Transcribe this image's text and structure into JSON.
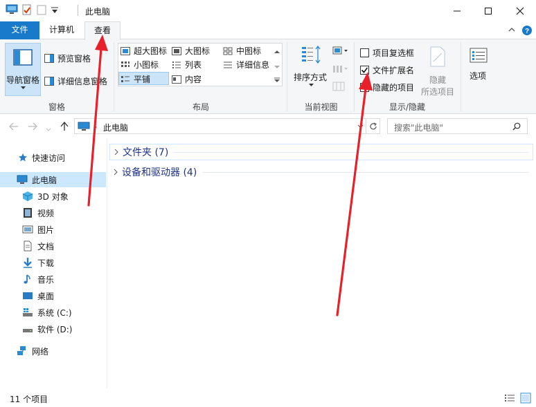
{
  "window": {
    "title": "此电脑",
    "controls": [
      "minimize",
      "maximize",
      "close"
    ]
  },
  "tabs": [
    {
      "label": "文件",
      "active": false
    },
    {
      "label": "计算机",
      "active": false
    },
    {
      "label": "查看",
      "active": true
    }
  ],
  "ribbon": {
    "panes": {
      "nav_pane": "导航窗格",
      "preview_pane": "预览窗格",
      "details_pane": "详细信息窗格",
      "group_label": "窗格"
    },
    "layout": {
      "items": [
        "超大图标",
        "大图标",
        "中图标",
        "小图标",
        "列表",
        "详细信息",
        "平铺",
        "内容"
      ],
      "selected": "平铺",
      "group_label": "布局"
    },
    "current_view": {
      "sort_by": "排序方式",
      "group_label": "当前视图"
    },
    "show_hide": {
      "item_checkboxes": {
        "label": "项目复选框",
        "checked": false
      },
      "file_extensions": {
        "label": "文件扩展名",
        "checked": true
      },
      "hidden_items": {
        "label": "隐藏的项目",
        "checked": false
      },
      "hide_selected_1": "隐藏",
      "hide_selected_2": "所选项目",
      "group_label": "显示/隐藏"
    },
    "options": "选项"
  },
  "address": {
    "path": "此电脑",
    "search_placeholder": "搜索\"此电脑\""
  },
  "nav": {
    "quick_access": "快速访问",
    "this_pc": "此电脑",
    "children": [
      "3D 对象",
      "视频",
      "图片",
      "文档",
      "下载",
      "音乐",
      "桌面",
      "系统 (C:)",
      "软件 (D:)"
    ],
    "network": "网络"
  },
  "content": {
    "groups": [
      {
        "label": "文件夹 (7)"
      },
      {
        "label": "设备和驱动器 (4)"
      }
    ]
  },
  "status": {
    "item_count": "11 个项目"
  },
  "colors": {
    "accent": "#1979ca",
    "selection": "#cce8ff",
    "group_heading": "#1e3287",
    "annotation_arrow": "#e8202a"
  }
}
